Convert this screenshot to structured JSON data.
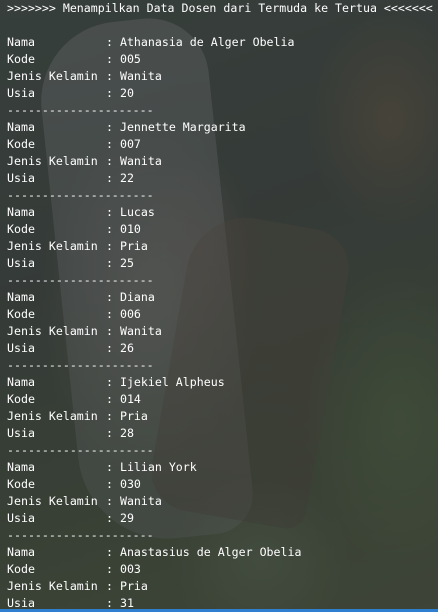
{
  "header": ">>>>>>> Menampilkan Data Dosen dari Termuda ke Tertua <<<<<<<",
  "separator": "---------------------",
  "labels": {
    "nama": "Nama",
    "kode": "Kode",
    "jenis_kelamin": "Jenis Kelamin",
    "usia": "Usia",
    "colon": ": "
  },
  "records": [
    {
      "nama": "Athanasia de Alger Obelia",
      "kode": "005",
      "jenis_kelamin": "Wanita",
      "usia": "20"
    },
    {
      "nama": "Jennette Margarita",
      "kode": "007",
      "jenis_kelamin": "Wanita",
      "usia": "22"
    },
    {
      "nama": "Lucas",
      "kode": "010",
      "jenis_kelamin": "Pria",
      "usia": "25"
    },
    {
      "nama": "Diana",
      "kode": "006",
      "jenis_kelamin": "Wanita",
      "usia": "26"
    },
    {
      "nama": "Ijekiel Alpheus",
      "kode": "014",
      "jenis_kelamin": "Pria",
      "usia": "28"
    },
    {
      "nama": "Lilian York",
      "kode": "030",
      "jenis_kelamin": "Wanita",
      "usia": "29"
    },
    {
      "nama": "Anastasius de Alger Obelia",
      "kode": "003",
      "jenis_kelamin": "Pria",
      "usia": "31"
    }
  ],
  "colors": {
    "text": "#ffffff",
    "accent_bar": "#2f7fd0"
  }
}
